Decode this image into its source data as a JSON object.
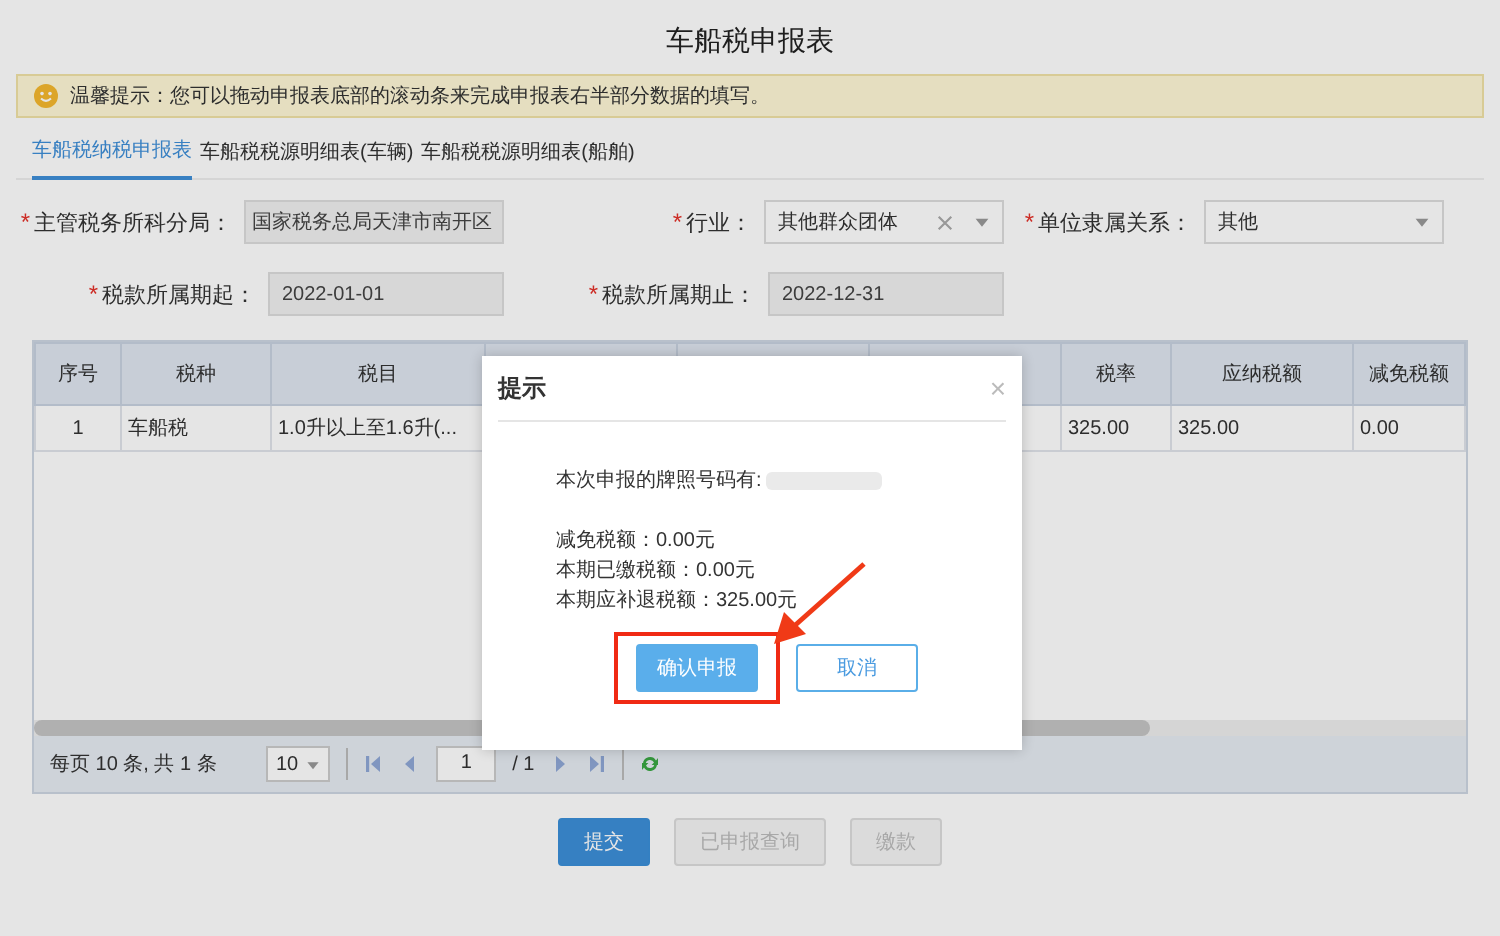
{
  "title": "车船税申报表",
  "notice": {
    "text": "温馨提示：您可以拖动申报表底部的滚动条来完成申报表右半部分数据的填写。"
  },
  "tabs": [
    {
      "label": "车船税纳税申报表",
      "selected": true
    },
    {
      "label": "车船税税源明细表(车辆)",
      "selected": false
    },
    {
      "label": "车船税税源明细表(船舶)",
      "selected": false
    }
  ],
  "fields": [
    {
      "label": "主管税务所科分局：",
      "value": "国家税务总局天津市南开区",
      "kind": "readonly",
      "required_mark": "*"
    },
    {
      "label": "行业：",
      "value": "其他群众团体",
      "kind": "select",
      "clearable": true,
      "required_mark": "*"
    },
    {
      "label": "单位隶属关系：",
      "value": "其他",
      "kind": "select",
      "clearable": false,
      "required_mark": "*"
    },
    {
      "label": "税款所属期起：",
      "value": "2022-01-01",
      "kind": "readonly",
      "required_mark": "*"
    },
    {
      "label": "税款所属期止：",
      "value": "2022-12-31",
      "kind": "readonly",
      "required_mark": "*"
    }
  ],
  "table": {
    "columns": [
      {
        "label": "序号"
      },
      {
        "label": "税种"
      },
      {
        "label": "税目"
      },
      {},
      {},
      {},
      {
        "label": "税率"
      },
      {
        "label": "应纳税额"
      },
      {
        "label": "减免税额"
      }
    ],
    "rows": [
      [
        "1",
        "车船税",
        "1.0升以上至1.6升(...",
        null,
        null,
        null,
        "325.00",
        "325.00",
        "0.00"
      ]
    ]
  },
  "pager": {
    "summary": "每页 10 条, 共 1 条",
    "page_size": "10",
    "page": "1",
    "total_pages": "/ 1"
  },
  "buttons": [
    {
      "label": "提交",
      "disabled": false
    },
    {
      "label": "已申报查询",
      "disabled": true
    },
    {
      "label": "缴款",
      "disabled": true
    }
  ],
  "dialog": {
    "title": "提示",
    "close": "×",
    "plate_label": "本次申报的牌照号码有:",
    "lines": [
      "减免税额：0.00元",
      "本期已缴税额：0.00元",
      "本期应补退税额：325.00元"
    ],
    "buttons": [
      {
        "label": "确认申报",
        "primary": true,
        "highlighted": true
      },
      {
        "label": "取消",
        "primary": false,
        "highlighted": false
      }
    ]
  }
}
